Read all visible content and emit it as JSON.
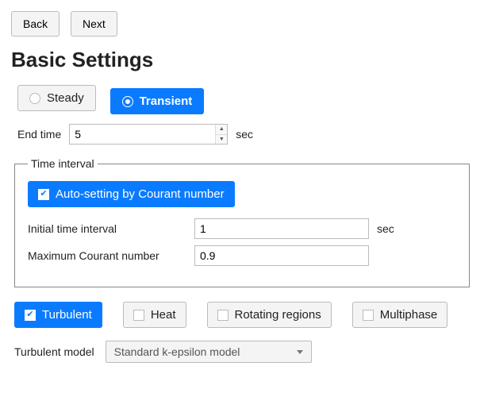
{
  "nav": {
    "back": "Back",
    "next": "Next"
  },
  "title": "Basic Settings",
  "mode": {
    "steady": "Steady",
    "transient": "Transient",
    "selected": "transient"
  },
  "end_time": {
    "label": "End time",
    "value": "5",
    "unit": "sec"
  },
  "time_interval": {
    "legend": "Time interval",
    "auto_label": "Auto-setting by Courant number",
    "auto_checked": true,
    "initial": {
      "label": "Initial time interval",
      "value": "1",
      "unit": "sec"
    },
    "max_courant": {
      "label": "Maximum Courant number",
      "value": "0.9"
    }
  },
  "options": {
    "turbulent": {
      "label": "Turbulent",
      "checked": true
    },
    "heat": {
      "label": "Heat",
      "checked": false
    },
    "rotating": {
      "label": "Rotating regions",
      "checked": false
    },
    "multiphase": {
      "label": "Multiphase",
      "checked": false
    }
  },
  "turbulent_model": {
    "label": "Turbulent model",
    "value": "Standard k-epsilon model"
  }
}
